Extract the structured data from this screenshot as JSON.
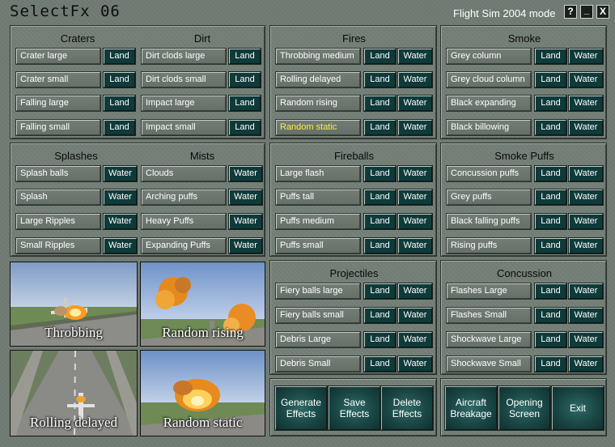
{
  "window": {
    "title": "SelectFx 06",
    "mode": "Flight Sim 2004 mode",
    "help_label": "?",
    "minimize_label": "_",
    "close_label": "X"
  },
  "labels": {
    "land": "Land",
    "water": "Water"
  },
  "craters_dirt": {
    "title_left": "Craters",
    "title_right": "Dirt",
    "left": [
      "Crater large",
      "Crater small",
      "Falling large",
      "Falling small"
    ],
    "right": [
      "Dirt clods large",
      "Dirt clods small",
      "Impact large",
      "Impact small"
    ]
  },
  "fires": {
    "title": "Fires",
    "items": [
      "Throbbing medium",
      "Rolling delayed",
      "Random rising",
      "Random static"
    ],
    "highlighted": "Random static"
  },
  "smoke": {
    "title": "Smoke",
    "items": [
      "Grey column",
      "Grey cloud column",
      "Black expanding",
      "Black billowing"
    ]
  },
  "splashes_mists": {
    "title_left": "Splashes",
    "title_right": "Mists",
    "left": [
      "Splash balls",
      "Splash",
      "Large Ripples",
      "Small Ripples"
    ],
    "right": [
      "Clouds",
      "Arching puffs",
      "Heavy Puffs",
      "Expanding Puffs"
    ]
  },
  "fireballs": {
    "title": "Fireballs",
    "items": [
      "Large flash",
      "Puffs tall",
      "Puffs medium",
      "Puffs small"
    ]
  },
  "smoke_puffs": {
    "title": "Smoke Puffs",
    "items": [
      "Concussion puffs",
      "Grey puffs",
      "Black falling puffs",
      "Rising puffs"
    ]
  },
  "projectiles": {
    "title": "Projectiles",
    "items": [
      "Fiery balls large",
      "Fiery balls small",
      "Debris Large",
      "Debris Small"
    ]
  },
  "concussion": {
    "title": "Concussion",
    "items": [
      "Flashes Large",
      "Flashes Small",
      "Shockwave Large",
      "Shockwave Small"
    ]
  },
  "previews": [
    "Throbbing",
    "Random rising",
    "Rolling delayed",
    "Random static"
  ],
  "actions": {
    "generate": "Generate\nEffects",
    "save": "Save\nEffects",
    "delete": "Delete\nEffects",
    "breakage": "Aircraft\nBreakage",
    "opening": "Opening\nScreen",
    "exit": "Exit"
  },
  "colors": {
    "highlight_text": "#ffee44",
    "button_bg": "#0f3a3a",
    "panel_bg": "#727d75"
  }
}
